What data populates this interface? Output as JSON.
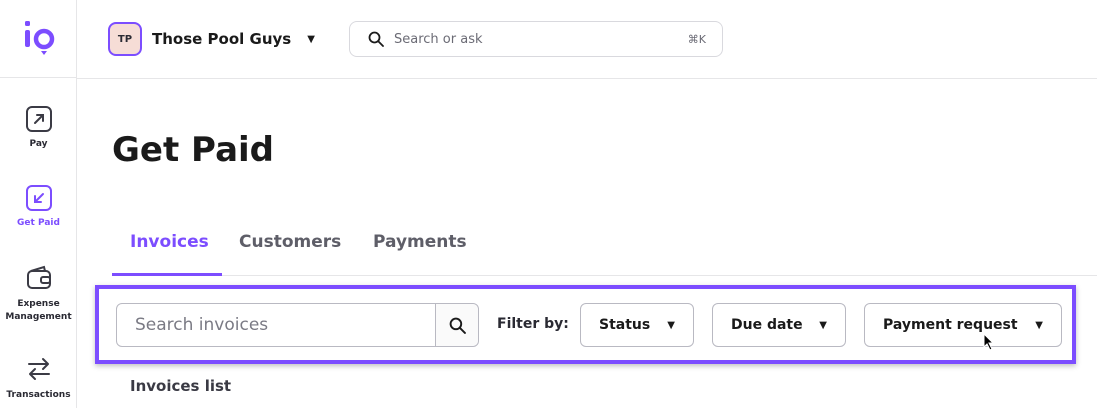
{
  "brand": {
    "logo_text": "io",
    "accent": "#7c4dff"
  },
  "sidebar": {
    "items": [
      {
        "label": "Pay",
        "icon": "arrow-up-right-icon",
        "active": false
      },
      {
        "label": "Get Paid",
        "icon": "arrow-down-left-icon",
        "active": true
      },
      {
        "label": "Expense Management",
        "icon": "wallet-icon",
        "active": false
      },
      {
        "label": "Transactions",
        "icon": "transfer-arrows-icon",
        "active": false
      }
    ]
  },
  "topbar": {
    "org_initials": "TP",
    "org_name": "Those Pool Guys",
    "search_placeholder": "Search or ask",
    "search_shortcut": "⌘K"
  },
  "main": {
    "title": "Get Paid",
    "tabs": [
      {
        "label": "Invoices",
        "active": true
      },
      {
        "label": "Customers",
        "active": false
      },
      {
        "label": "Payments",
        "active": false
      }
    ],
    "filters": {
      "search_placeholder": "Search invoices",
      "filter_label": "Filter by:",
      "dropdowns": [
        {
          "label": "Status"
        },
        {
          "label": "Due date"
        },
        {
          "label": "Payment request"
        }
      ]
    },
    "list_title": "Invoices list"
  }
}
